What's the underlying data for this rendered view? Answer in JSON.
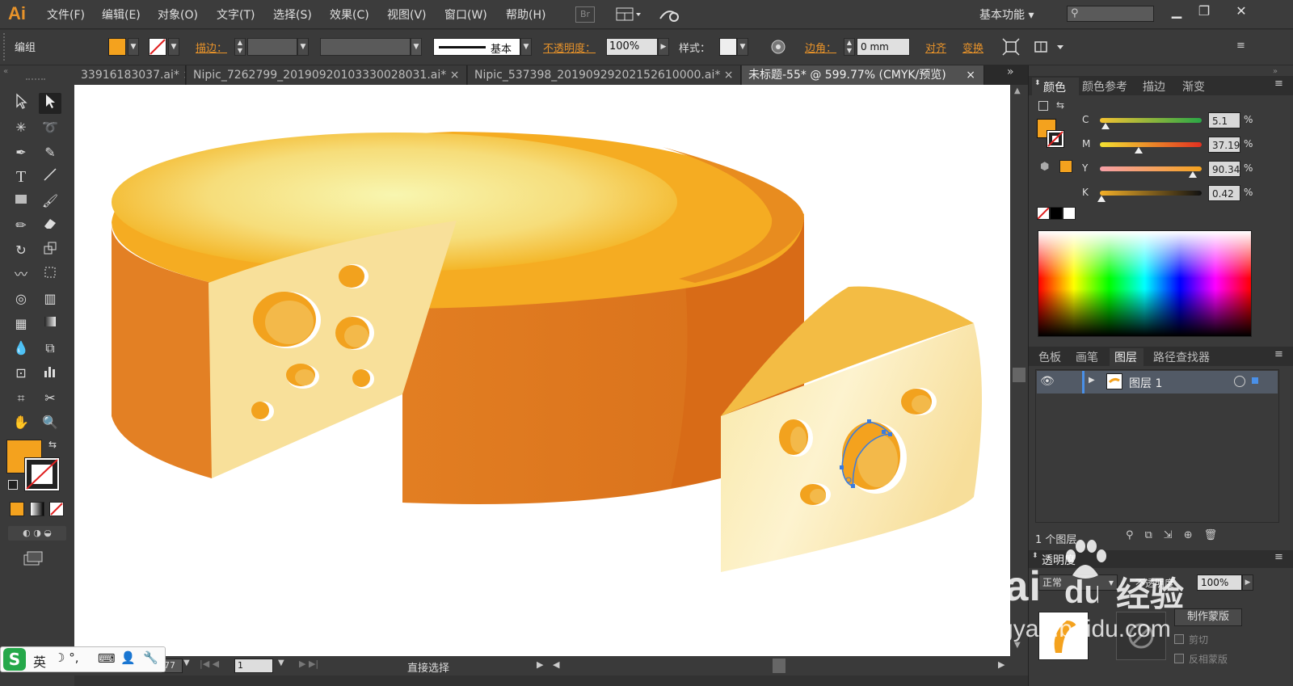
{
  "app": {
    "logo": "Ai",
    "menus": [
      "文件(F)",
      "编辑(E)",
      "对象(O)",
      "文字(T)",
      "选择(S)",
      "效果(C)",
      "视图(V)",
      "窗口(W)",
      "帮助(H)"
    ],
    "bridge": "Br",
    "workspace": "基本功能",
    "search_placeholder": ""
  },
  "control": {
    "group_label": "编组",
    "stroke_label": "描边：",
    "stroke_style": "基本",
    "opacity_label": "不透明度：",
    "opacity_value": "100%",
    "style_label": "样式：",
    "corner_label": "边角：",
    "corner_value": "0 mm",
    "align_label": "对齐",
    "transform_label": "变换"
  },
  "tabs": [
    {
      "label": "33916183037.ai*"
    },
    {
      "label": "Nipic_7262799_20190920103330028031.ai*"
    },
    {
      "label": "Nipic_537398_20190929202152610000.ai*"
    },
    {
      "label": "未标题-55* @ 599.77% (CMYK/预览)"
    }
  ],
  "color_panel": {
    "tabs": [
      "颜色",
      "颜色参考",
      "描边",
      "渐变"
    ],
    "channels": [
      {
        "name": "C",
        "value": "5.1",
        "pct": 0.051
      },
      {
        "name": "M",
        "value": "37.19",
        "pct": 0.372
      },
      {
        "name": "Y",
        "value": "90.34",
        "pct": 0.903
      },
      {
        "name": "K",
        "value": "0.42",
        "pct": 0.004
      }
    ],
    "pct_sign": "%",
    "fill_color": "#f4a21e"
  },
  "layers_panel": {
    "tabs": [
      "色板",
      "画笔",
      "图层",
      "路径查找器"
    ],
    "layer_name": "图层 1",
    "count_label": "1 个图层"
  },
  "transparency_panel": {
    "title": "透明度",
    "mode": "正常",
    "opacity_label": "不透明度",
    "opacity_value": "100%",
    "make_mask": "制作蒙版",
    "clip": "剪切",
    "invert_mask": "反相蒙版"
  },
  "status": {
    "zoom": "77",
    "page": "1",
    "tool_name": "直接选择"
  },
  "ime": {
    "lang": "英"
  },
  "watermark": {
    "brand": "Bai",
    "brand_cn": "经验",
    "url": "jingyan.baidu.com"
  },
  "colors": {
    "accent": "#e8932a",
    "cheese_light": "#f8e39a",
    "cheese_orange": "#e27e22"
  }
}
